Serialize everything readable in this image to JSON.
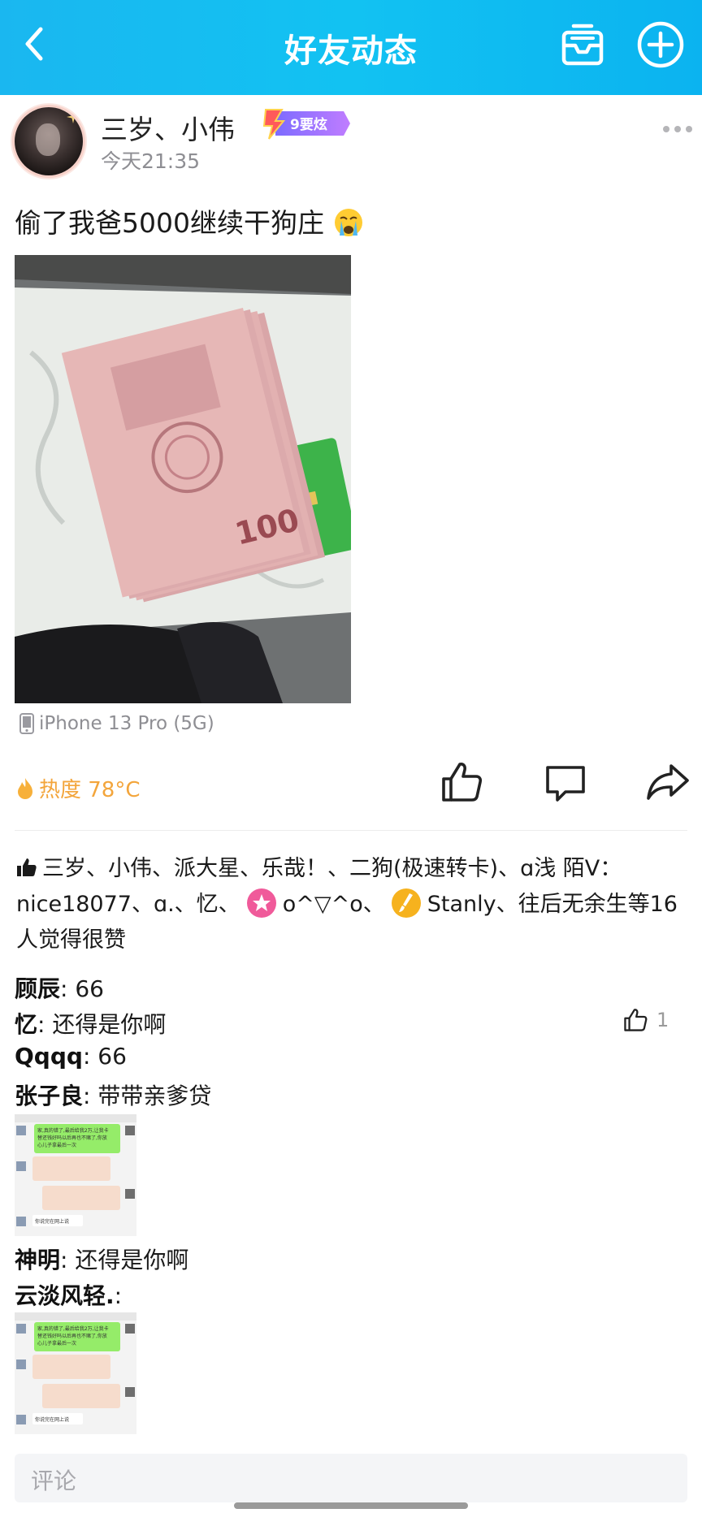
{
  "header": {
    "title": "好友动态",
    "back_icon": "chevron-left-icon",
    "mail_icon": "mail-icon",
    "add_icon": "plus-circle-icon",
    "bg_color": "#12c2f2"
  },
  "post": {
    "username": "三岁、小伟",
    "vip_badge": "9要炫",
    "time": "今天21:35",
    "text": "偷了我爸5000继续干狗庄",
    "device": "iPhone 13 Pro (5G)",
    "heat": "热度 78°C"
  },
  "likes": {
    "text_part1": "三岁、小伟、派大星、乐哉！、二狗(极速转卡)、ɑ浅 陌V：nice18077、ɑ.、忆、",
    "text_part2": "o^▽^o、",
    "text_part3": "Stanly、往后无余生等16人觉得很赞"
  },
  "comments": [
    {
      "user": "顾辰",
      "text": ": 66"
    },
    {
      "user": "忆",
      "text": ": 还得是你啊",
      "likes": "1"
    },
    {
      "user": "Qqqq",
      "text": ": 66"
    },
    {
      "user": "张子良",
      "text": ": 带带亲爹贷"
    },
    {
      "user": "神明",
      "text": ": 还得是你啊"
    },
    {
      "user": "云淡风轻.",
      "text": ":"
    }
  ],
  "chat_thumb": {
    "line1": "家,真的错了,最后给我2万,让我卡",
    "line2": "替还钱好吗以后再也不赌了,你放",
    "line3": "心儿子拿最后一次",
    "footer": "你说完在网上说"
  },
  "comment_input": {
    "placeholder": "评论"
  }
}
